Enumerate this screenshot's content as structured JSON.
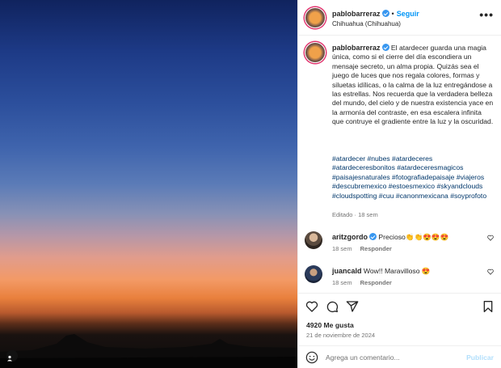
{
  "post": {
    "author": "pablobarreraz",
    "follow_label": "Seguir",
    "dot": "•",
    "location": "Chihuahua (Chihuahua)",
    "more_label": "•••"
  },
  "caption": {
    "author": "pablobarreraz",
    "text": "El atardecer guarda una magia única, como si el cierre del día escondiera un mensaje secreto, un alma propia. Quizás sea el juego de luces que nos regala colores, formas y siluetas idílicas, o la calma de la luz entregándose a las estrellas. Nos recuerda que la verdadera belleza del mundo, del cielo y de nuestra existencia yace en la armonía del contraste, en esa escalera infinita que contruye el gradiente entre la luz y la oscuridad.",
    "hashtags": "#atardecer #nubes #atardeceres #atardeceresbonitos #atardeceresmagicos #paisajesnaturales #fotografiadepaisaje #viajeros #descubremexico #estoesmexico #skyandclouds #cloudspotting #cuu #canonmexicana #soyprofoto",
    "edited": "Editado · 18 sem"
  },
  "comments": [
    {
      "author": "aritzgordo",
      "text": "Precioso👏👏😍😍😍",
      "time": "18 sem",
      "reply": "Responder"
    },
    {
      "author": "juancald",
      "text": "Wow!! Maravilloso 😍",
      "time": "18 sem",
      "reply": "Responder"
    }
  ],
  "engagement": {
    "likes": "4920 Me gusta",
    "date": "21 de noviembre de 2024"
  },
  "composer": {
    "placeholder": "Agrega un comentario...",
    "publish": "Publicar"
  },
  "colors": {
    "accent": "#0095f6",
    "verified": "#3897f0",
    "hashtag": "#00376b",
    "muted": "#737373"
  },
  "icons": [
    "user-tag-icon",
    "verified-icon",
    "more-icon",
    "heart-icon",
    "comment-icon",
    "share-icon",
    "bookmark-icon",
    "emoji-icon"
  ]
}
